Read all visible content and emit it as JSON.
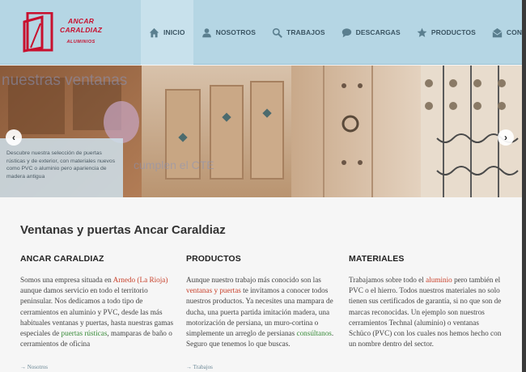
{
  "logo": {
    "line1": "ANCAR",
    "line2": "CARALDIAZ",
    "line3": "ALUMINIOS"
  },
  "nav": [
    {
      "label": "INICIO",
      "icon": "home-icon"
    },
    {
      "label": "NOSOTROS",
      "icon": "user-icon"
    },
    {
      "label": "TRABAJOS",
      "icon": "search-icon"
    },
    {
      "label": "DESCARGAS",
      "icon": "chat-icon"
    },
    {
      "label": "PRODUCTOS",
      "icon": "star-icon"
    },
    {
      "label": "CONTACTO",
      "icon": "mail-icon"
    }
  ],
  "hero": {
    "caption": "Descubre nuestra selección de puertas rústicas y de exterior, con materiales nuevos como PVC o aluminio pero apariencia de madera antigua",
    "prev_symbol": "‹",
    "next_symbol": "›",
    "watermark_top": "nuestras ventanas",
    "watermark_bottom": "cumplen el CTE"
  },
  "page_title": "Ventanas y puertas Ancar Caraldiaz",
  "columns": [
    {
      "title": "ANCAR CARALDIAZ",
      "p1": "Somos una empresa situada en ",
      "h1": "Arnedo (La Rioja)",
      "p2": " aunque damos servicio en todo el territorio peninsular. Nos dedicamos a todo tipo de cerramientos en aluminio y PVC, desde las más habituales ventanas y puertas, hasta nuestras gamas especiales de ",
      "h2": "puertas rústicas",
      "p3": ", mamparas de baño o cerramientos de oficina",
      "more": "→ Nosotros"
    },
    {
      "title": "PRODUCTOS",
      "p1": "Aunque nuestro trabajo más conocido son las ",
      "h1": "ventanas y puertas",
      "p2": " te invitamos a conocer todos nuestros productos. Ya necesites una mampara de ducha, una puerta partida imitación madera, una motorización de persiana, un muro-cortina o simplemente un arreglo de persianas ",
      "h2": "consúltanos",
      "p3": ". Seguro que tenemos lo que buscas.",
      "more": "→ Trabajos"
    },
    {
      "title": "MATERIALES",
      "p1": "Trabajamos sobre todo el ",
      "h1": "aluminio",
      "p2": " pero también el PVC o el hierro. Todos nuestros materiales no solo tienen sus certificados de garantía, si no que son de marcas reconocidas. Un ejemplo son nuestros cerramientos Technal (aluminio) o ventanas Schüco (PVC) con los cuales nos hemos hecho con un nombre dentro del sector.",
      "h2": "",
      "p3": "",
      "more": ""
    }
  ],
  "colors": {
    "header": "#b5d6e4",
    "accent": "#c8102e",
    "link": "#c8412b",
    "link_green": "#3a8c3a",
    "nav_text": "#3b5563"
  }
}
